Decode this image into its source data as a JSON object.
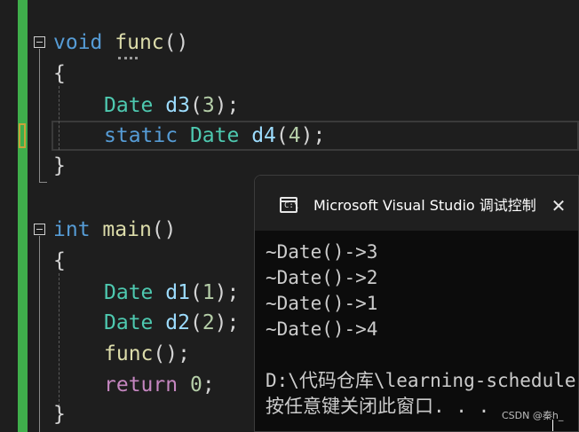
{
  "editor": {
    "func_def": {
      "type": "void",
      "name": "func",
      "parens": "()"
    },
    "func_body": [
      {
        "type": "Date",
        "var": "d3",
        "open": "(",
        "arg": "3",
        "close": ");"
      },
      {
        "kw": "static",
        "type": "Date",
        "var": "d4",
        "open": "(",
        "arg": "4",
        "close": ");"
      }
    ],
    "main_def": {
      "type": "int",
      "name": "main",
      "parens": "()"
    },
    "main_body": [
      {
        "type": "Date",
        "var": "d1",
        "open": "(",
        "arg": "1",
        "close": ");"
      },
      {
        "type": "Date",
        "var": "d2",
        "open": "(",
        "arg": "2",
        "close": ");"
      },
      {
        "call": "func",
        "after": "();"
      },
      {
        "kw": "return",
        "val": "0",
        "after": ";"
      }
    ],
    "brace_open": "{",
    "brace_close": "}"
  },
  "console": {
    "icon": "console-icon",
    "icon_glyph": "C:\\",
    "title": "Microsoft Visual Studio 调试控制台",
    "close_glyph": "✕",
    "lines": [
      "~Date()->3",
      "~Date()->2",
      "~Date()->1",
      "~Date()->4",
      "",
      "D:\\代码仓库\\learning-schedule",
      "按任意键关闭此窗口. . ."
    ]
  },
  "watermark": "CSDN @秦h_",
  "colors": {
    "keyword": "#569cd6",
    "control": "#c586c0",
    "type": "#4ec9b0",
    "function": "#dcdcaa",
    "variable": "#9cdcfe",
    "number": "#b5cea8",
    "change_bar": "#3fae4b"
  }
}
